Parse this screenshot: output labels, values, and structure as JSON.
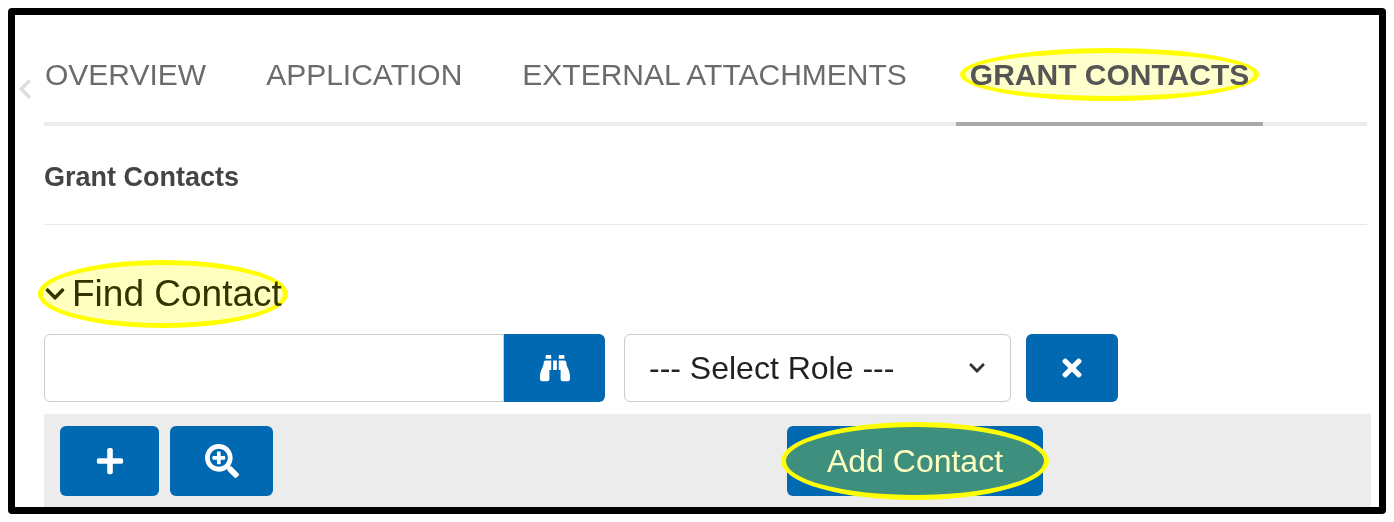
{
  "tabs": [
    {
      "label": "OVERVIEW",
      "selected": false,
      "highlighted": false
    },
    {
      "label": "APPLICATION",
      "selected": false,
      "highlighted": false
    },
    {
      "label": "EXTERNAL ATTACHMENTS",
      "selected": false,
      "highlighted": false
    },
    {
      "label": "GRANT CONTACTS",
      "selected": true,
      "highlighted": true
    }
  ],
  "section_title": "Grant Contacts",
  "find_contact": {
    "label": "Find Contact",
    "expanded": true,
    "highlighted": true
  },
  "role_select": {
    "value": "--- Select Role ---"
  },
  "add_contact_button": {
    "label": "Add Contact",
    "highlighted": true
  }
}
